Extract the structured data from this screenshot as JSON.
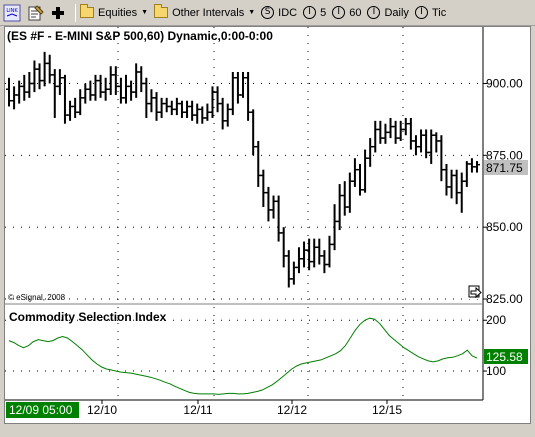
{
  "toolbar": {
    "link_label": "LINK",
    "equities_label": "Equities",
    "other_intervals_label": "Other Intervals",
    "s_badge": "S",
    "idc_label": "IDC",
    "i_badge": "I",
    "interval_5": "5",
    "interval_60": "60",
    "interval_daily": "Daily",
    "interval_tick": "Tic"
  },
  "chart": {
    "title": "(ES #F - E-MINI S&P 500,60) Dynamic,0:00-0:00",
    "copyright": "© eSignal, 2008",
    "price_axis_labels": [
      "900.00",
      "875.00",
      "850.00",
      "825.00"
    ],
    "last_price": "871.75",
    "indicator_title": "Commodity Selection Index",
    "indicator_axis_labels": [
      "200",
      "100"
    ],
    "indicator_last_value": "125.58",
    "current_time_label": "12/09 05:00",
    "date_labels": [
      "12/10",
      "12/11",
      "12/12",
      "12/15"
    ],
    "colors": {
      "price_bars": "#000000",
      "indicator_line": "#008000",
      "last_value_bg": "#008000",
      "last_price_bg": "#c0c0c0"
    }
  },
  "chart_data": [
    {
      "type": "ohlc",
      "title": "(ES #F - E-MINI S&P 500,60) Dynamic,0:00-0:00",
      "x_labels": [
        "12/10",
        "12/11",
        "12/12",
        "12/15"
      ],
      "ylim": [
        825,
        912
      ],
      "y_ticks": [
        825,
        850,
        875,
        900
      ],
      "last": 871.75,
      "series": [
        {
          "values": [
            [
              898,
              894,
              902,
              892
            ],
            [
              894,
              896,
              899,
              891
            ],
            [
              896,
              899,
              901,
              893
            ],
            [
              899,
              897,
              903,
              894
            ],
            [
              897,
              900,
              904,
              895
            ],
            [
              900,
              905,
              908,
              897
            ],
            [
              905,
              901,
              907,
              898
            ],
            [
              901,
              907,
              911,
              899
            ],
            [
              907,
              903,
              910,
              900
            ],
            [
              903,
              899,
              905,
              888
            ],
            [
              899,
              902,
              905,
              896
            ],
            [
              902,
              889,
              903,
              886
            ],
            [
              889,
              892,
              894,
              887
            ],
            [
              892,
              890,
              895,
              888
            ],
            [
              890,
              895,
              898,
              889
            ],
            [
              895,
              898,
              900,
              893
            ],
            [
              898,
              896,
              901,
              894
            ],
            [
              896,
              901,
              903,
              894
            ],
            [
              901,
              897,
              903,
              895
            ],
            [
              897,
              898,
              902,
              894
            ],
            [
              898,
              903,
              906,
              896
            ],
            [
              903,
              899,
              906,
              896
            ],
            [
              899,
              895,
              902,
              893
            ],
            [
              895,
              899,
              903,
              893
            ],
            [
              899,
              897,
              901,
              894
            ],
            [
              897,
              904,
              907,
              895
            ],
            [
              904,
              900,
              906,
              897
            ],
            [
              900,
              893,
              902,
              888
            ],
            [
              893,
              895,
              898,
              890
            ],
            [
              895,
              890,
              897,
              887
            ],
            [
              890,
              893,
              895,
              888
            ],
            [
              893,
              892,
              895,
              890
            ],
            [
              892,
              891,
              894,
              889
            ],
            [
              891,
              893,
              895,
              889
            ],
            [
              893,
              890,
              894,
              888
            ],
            [
              890,
              892,
              894,
              888
            ],
            [
              892,
              889,
              894,
              887
            ],
            [
              889,
              891,
              893,
              886
            ],
            [
              891,
              888,
              892,
              886
            ],
            [
              888,
              890,
              893,
              887
            ],
            [
              890,
              897,
              899,
              888
            ],
            [
              897,
              893,
              899,
              890
            ],
            [
              893,
              887,
              895,
              884
            ],
            [
              887,
              891,
              893,
              885
            ],
            [
              891,
              902,
              904,
              889
            ],
            [
              902,
              896,
              904,
              893
            ],
            [
              896,
              902,
              904,
              895
            ],
            [
              902,
              890,
              904,
              887
            ],
            [
              890,
              878,
              891,
              875
            ],
            [
              878,
              868,
              880,
              864
            ],
            [
              868,
              862,
              870,
              857
            ],
            [
              862,
              856,
              864,
              852
            ],
            [
              856,
              859,
              861,
              853
            ],
            [
              859,
              848,
              861,
              845
            ],
            [
              848,
              840,
              850,
              836
            ],
            [
              840,
              832,
              842,
              829
            ],
            [
              832,
              836,
              838,
              830
            ],
            [
              836,
              839,
              843,
              834
            ],
            [
              839,
              842,
              845,
              836
            ],
            [
              842,
              838,
              846,
              835
            ],
            [
              838,
              843,
              846,
              836
            ],
            [
              843,
              840,
              846,
              837
            ],
            [
              840,
              837,
              842,
              834
            ],
            [
              837,
              844,
              847,
              836
            ],
            [
              844,
              852,
              858,
              842
            ],
            [
              852,
              861,
              865,
              849
            ],
            [
              861,
              857,
              866,
              854
            ],
            [
              857,
              866,
              869,
              855
            ],
            [
              866,
              870,
              874,
              864
            ],
            [
              870,
              863,
              872,
              861
            ],
            [
              863,
              874,
              877,
              862
            ],
            [
              874,
              878,
              881,
              871
            ],
            [
              878,
              884,
              887,
              876
            ],
            [
              884,
              881,
              887,
              879
            ],
            [
              881,
              883,
              886,
              879
            ],
            [
              883,
              885,
              888,
              881
            ],
            [
              885,
              881,
              887,
              879
            ],
            [
              881,
              884,
              887,
              880
            ],
            [
              884,
              886,
              888,
              882
            ],
            [
              886,
              880,
              888,
              877
            ],
            [
              880,
              878,
              882,
              875
            ],
            [
              878,
              882,
              884,
              876
            ],
            [
              882,
              876,
              884,
              874
            ],
            [
              876,
              882,
              884,
              872
            ],
            [
              882,
              880,
              883,
              876
            ],
            [
              880,
              870,
              882,
              866
            ],
            [
              870,
              864,
              872,
              861
            ],
            [
              864,
              868,
              870,
              860
            ],
            [
              868,
              862,
              870,
              858
            ],
            [
              862,
              866,
              869,
              855
            ],
            [
              866,
              872,
              873,
              864
            ],
            [
              872,
              871,
              874,
              869
            ],
            [
              871,
              871.75,
              873,
              869
            ]
          ]
        }
      ]
    },
    {
      "type": "line",
      "title": "Commodity Selection Index",
      "ylim": [
        45,
        230
      ],
      "y_ticks": [
        100,
        200
      ],
      "last": 125.58,
      "series": [
        {
          "values": [
            160,
            156,
            150,
            146,
            150,
            158,
            162,
            160,
            158,
            160,
            165,
            168,
            165,
            158,
            150,
            142,
            132,
            122,
            114,
            108,
            104,
            102,
            100,
            98,
            97,
            96,
            94,
            92,
            90,
            88,
            85,
            82,
            78,
            75,
            70,
            66,
            62,
            58,
            56,
            55,
            55,
            55,
            55,
            54,
            55,
            56,
            56,
            55,
            55,
            56,
            58,
            60,
            63,
            68,
            73,
            80,
            88,
            96,
            104,
            110,
            114,
            116,
            118,
            120,
            122,
            126,
            130,
            134,
            140,
            150,
            165,
            180,
            192,
            200,
            204,
            202,
            194,
            182,
            170,
            162,
            154,
            146,
            140,
            134,
            128,
            124,
            120,
            118,
            120,
            124,
            126,
            127,
            130,
            134,
            141,
            130,
            125.58
          ]
        }
      ]
    }
  ]
}
